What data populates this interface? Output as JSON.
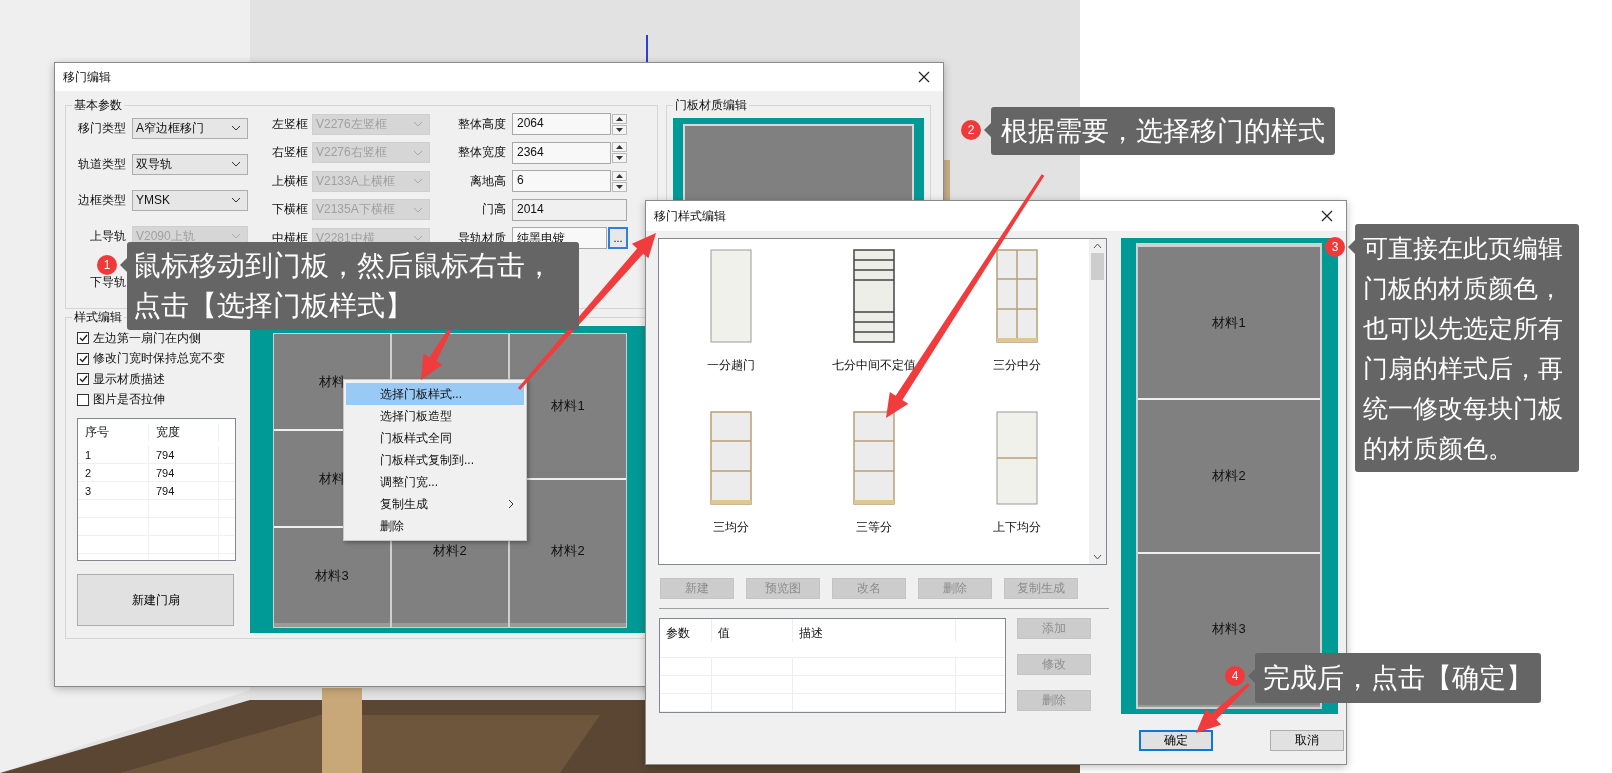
{
  "door_editor": {
    "title": "移门编辑",
    "basic_params": {
      "title": "基本参数",
      "column_1": [
        {
          "label": "移门类型",
          "value": "A窄边框移门",
          "disabled": false
        },
        {
          "label": "轨道类型",
          "value": "双导轨",
          "disabled": false
        },
        {
          "label": "边框类型",
          "value": "YMSK",
          "disabled": false
        },
        {
          "label": "上导轨",
          "value": "V2090上轨",
          "disabled": true
        },
        {
          "label": "下导轨"
        }
      ],
      "column_2": [
        {
          "label": "左竖框",
          "value": "V2276左竖框",
          "disabled": true
        },
        {
          "label": "右竖框",
          "value": "V2276右竖框",
          "disabled": true
        },
        {
          "label": "上横框",
          "value": "V2133A上横框",
          "disabled": true
        },
        {
          "label": "下横框",
          "value": "V2135A下横框",
          "disabled": true
        },
        {
          "label": "中横框",
          "value": "V2281中横",
          "disabled": true
        }
      ],
      "column_3": [
        {
          "label": "整体高度",
          "value": "2064",
          "kind": "spin"
        },
        {
          "label": "整体宽度",
          "value": "2364",
          "kind": "spin"
        },
        {
          "label": "离地高",
          "value": "6",
          "kind": "spin"
        },
        {
          "label": "门高",
          "value": "2014",
          "kind": "plain"
        },
        {
          "label": "导轨材质",
          "value": "纯黑电镀",
          "kind": "browse",
          "button": "..."
        }
      ]
    },
    "material_group": {
      "title": "门板材质编辑"
    },
    "style_group": {
      "title": "样式编辑",
      "options": [
        {
          "label": "左边第一扇门在内侧",
          "checked": true
        },
        {
          "label": "修改门宽时保持总宽不变",
          "checked": true
        },
        {
          "label": "显示材质描述",
          "checked": true
        },
        {
          "label": "图片是否拉伸",
          "checked": false
        }
      ],
      "table": {
        "columns": [
          "序号",
          "宽度"
        ],
        "rows": [
          [
            "1",
            "794"
          ],
          [
            "2",
            "794"
          ],
          [
            "3",
            "794"
          ]
        ]
      },
      "new_button": "新建门扇",
      "preview": [
        {
          "covered": false,
          "labels": [
            "材料",
            "材料",
            "材料3"
          ]
        },
        {
          "covered": true,
          "labels": [
            "材料2"
          ]
        },
        {
          "covered": false,
          "labels": [
            "材料1",
            "材料2"
          ]
        }
      ]
    }
  },
  "context_menu": [
    {
      "label": "选择门板样式...",
      "selected": true,
      "submenu": false
    },
    {
      "label": "选择门板造型",
      "selected": false,
      "submenu": false
    },
    {
      "label": "门板样式全同",
      "selected": false,
      "submenu": false
    },
    {
      "label": "门板样式复制到...",
      "selected": false,
      "submenu": false
    },
    {
      "label": "调整门宽...",
      "selected": false,
      "submenu": false
    },
    {
      "label": "复制生成",
      "selected": false,
      "submenu": true
    },
    {
      "label": "删除",
      "selected": false,
      "submenu": false
    }
  ],
  "style_editor": {
    "title": "移门样式编辑",
    "styles": [
      {
        "name": "一分趟门",
        "kind": "single",
        "selected": false
      },
      {
        "name": "七分中间不定值",
        "kind": "seven",
        "selected": false
      },
      {
        "name": "三分中分",
        "kind": "grid6",
        "selected": false
      },
      {
        "name": "三均分",
        "kind": "three",
        "selected": false
      },
      {
        "name": "三等分",
        "kind": "three",
        "selected": false
      },
      {
        "name": "上下均分",
        "kind": "two",
        "selected": false
      }
    ],
    "actions": [
      {
        "label": "新建",
        "disabled": true
      },
      {
        "label": "预览图",
        "disabled": true
      },
      {
        "label": "改名",
        "disabled": true
      },
      {
        "label": "删除",
        "disabled": true
      },
      {
        "label": "复制生成",
        "disabled": true
      }
    ],
    "param_table": {
      "columns": [
        "参数",
        "值",
        "描述"
      ]
    },
    "param_actions": [
      {
        "label": "添加",
        "disabled": true
      },
      {
        "label": "修改",
        "disabled": true
      },
      {
        "label": "删除",
        "disabled": true
      }
    ],
    "preview": [
      "材料1",
      "材料2",
      "材料3"
    ],
    "buttons": [
      {
        "label": "确定",
        "focused": true
      },
      {
        "label": "取消",
        "focused": false
      }
    ]
  },
  "callouts": [
    {
      "number": "1",
      "text": "鼠标移动到门板，然后鼠标右击，点击【选择门板样式】"
    },
    {
      "number": "2",
      "text": "根据需要，选择移门的样式"
    },
    {
      "number": "3",
      "text": "可直接在此页编辑门板的材质颜色，也可以先选定所有门扇的样式后，再统一修改每块门板的材质颜色。"
    },
    {
      "number": "4",
      "text": "完成后，点击【确定】"
    }
  ]
}
